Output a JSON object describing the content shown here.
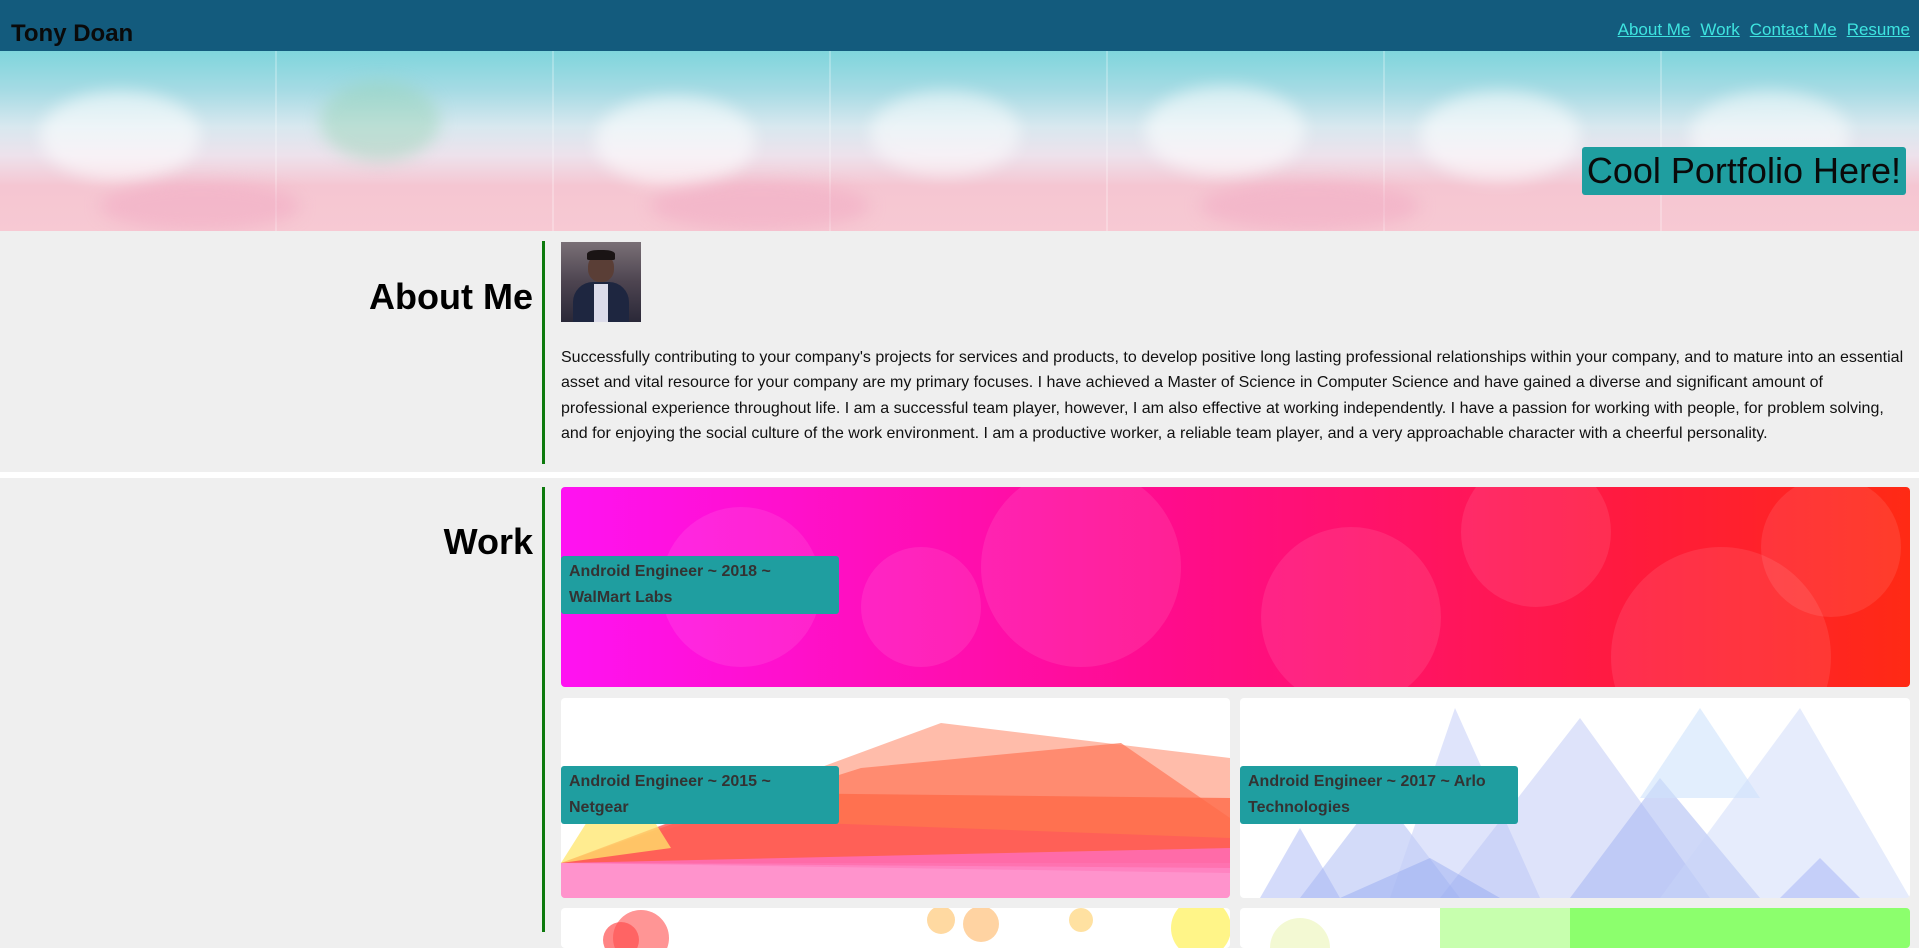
{
  "header": {
    "title": "Tony Doan",
    "nav": [
      {
        "label": "About Me"
      },
      {
        "label": "Work"
      },
      {
        "label": "Contact Me"
      },
      {
        "label": "Resume"
      }
    ]
  },
  "hero": {
    "badge": "Cool Portfolio Here!"
  },
  "about": {
    "heading": "About Me",
    "text": "Successfully contributing to your company's projects for services and products, to develop positive long lasting professional relationships within your company, and to mature into an essential asset and vital resource for your company are my primary focuses. I have achieved a Master of Science in Computer Science and have gained a diverse and significant amount of professional experience throughout life. I am a successful team player, however, I am also effective at working independently. I have a passion for working with people, for problem solving, and for enjoying the social culture of the work environment. I am a productive worker, a reliable team player, and a very approachable character with a cheerful personality."
  },
  "work": {
    "heading": "Work",
    "cards": [
      {
        "label": "Android Engineer ~ 2018 ~ WalMart Labs"
      },
      {
        "label": "Android Engineer ~ 2015 ~ Netgear"
      },
      {
        "label": "Android Engineer ~ 2017 ~ Arlo Technologies"
      }
    ]
  },
  "colors": {
    "header_bg": "#135b7d",
    "nav_link": "#3ee4e0",
    "accent_teal": "#1f9ea0",
    "section_line": "#0d7a0d",
    "page_bg": "#efefef"
  }
}
